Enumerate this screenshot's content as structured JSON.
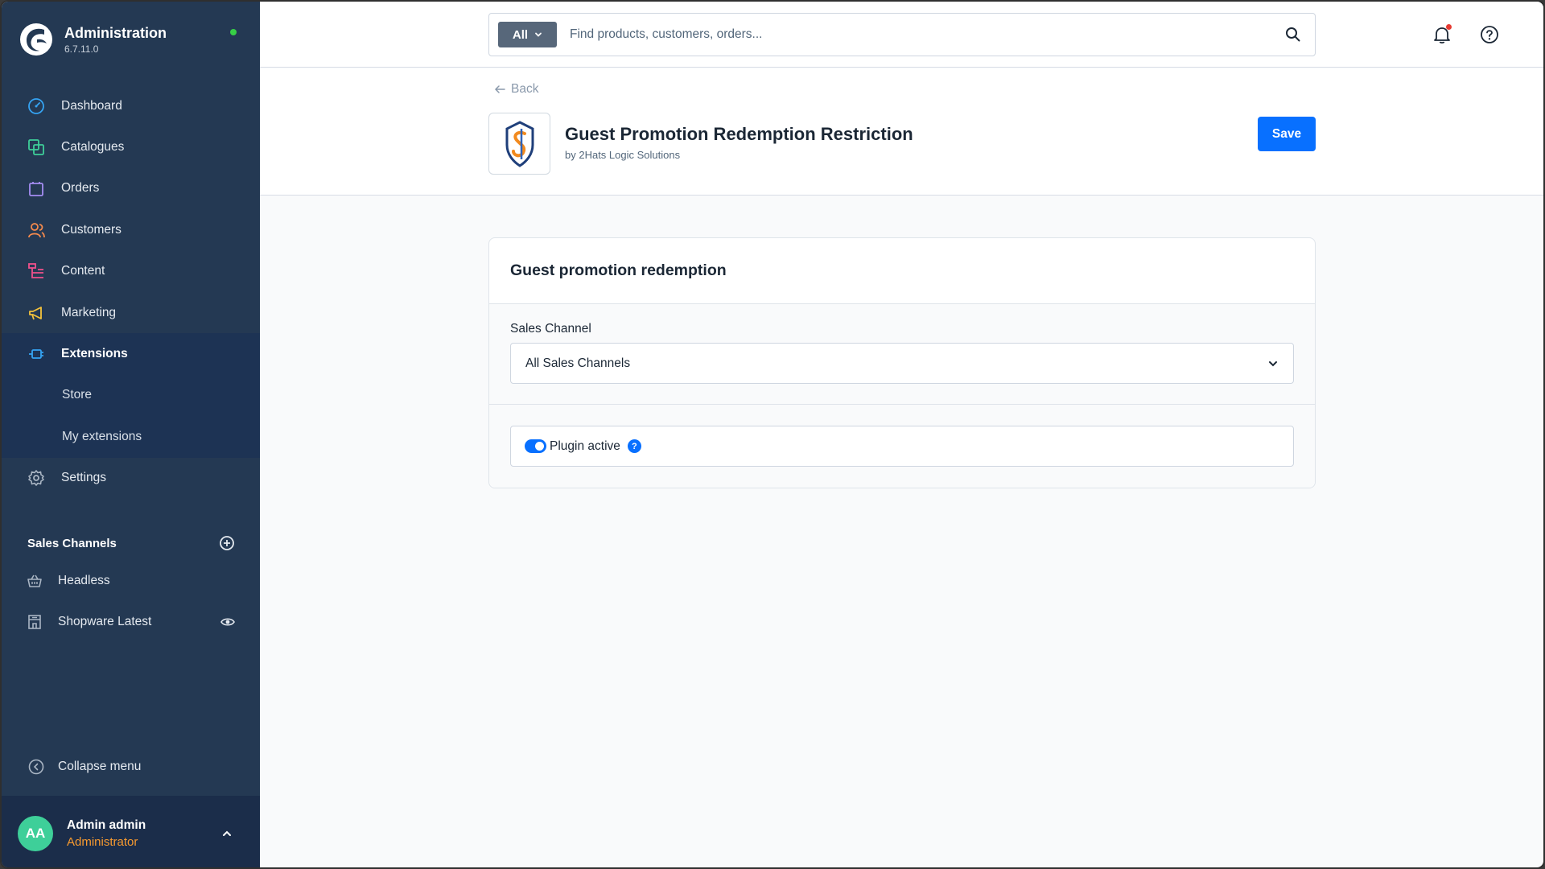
{
  "app": {
    "title": "Administration",
    "version": "6.7.11.0",
    "online_status_color": "#37d046"
  },
  "sidebar": {
    "items": [
      {
        "label": "Dashboard",
        "icon": "dashboard-icon"
      },
      {
        "label": "Catalogues",
        "icon": "catalogue-icon"
      },
      {
        "label": "Orders",
        "icon": "orders-icon"
      },
      {
        "label": "Customers",
        "icon": "customers-icon"
      },
      {
        "label": "Content",
        "icon": "content-icon"
      },
      {
        "label": "Marketing",
        "icon": "marketing-icon"
      },
      {
        "label": "Extensions",
        "icon": "extensions-icon",
        "active": true
      },
      {
        "label": "Store"
      },
      {
        "label": "My extensions"
      },
      {
        "label": "Settings",
        "icon": "settings-icon"
      }
    ],
    "sales_channels_title": "Sales Channels",
    "sales_channels": [
      {
        "label": "Headless",
        "icon": "basket-icon"
      },
      {
        "label": "Shopware Latest",
        "icon": "storefront-icon"
      }
    ],
    "collapse_label": "Collapse menu"
  },
  "user": {
    "initials": "AA",
    "name": "Admin admin",
    "role": "Administrator"
  },
  "search": {
    "type": "All",
    "placeholder": "Find products, customers, orders..."
  },
  "page": {
    "back_label": "Back",
    "plugin_title": "Guest Promotion Redemption Restriction",
    "plugin_vendor": "by 2Hats Logic Solutions",
    "save_label": "Save"
  },
  "card": {
    "title": "Guest promotion redemption",
    "sales_channel_label": "Sales Channel",
    "sales_channel_value": "All Sales Channels",
    "plugin_active_label": "Plugin active",
    "plugin_active": true
  },
  "colors": {
    "sidebar": "#243953",
    "accent": "#0870ff",
    "role": "#f89a2f"
  }
}
